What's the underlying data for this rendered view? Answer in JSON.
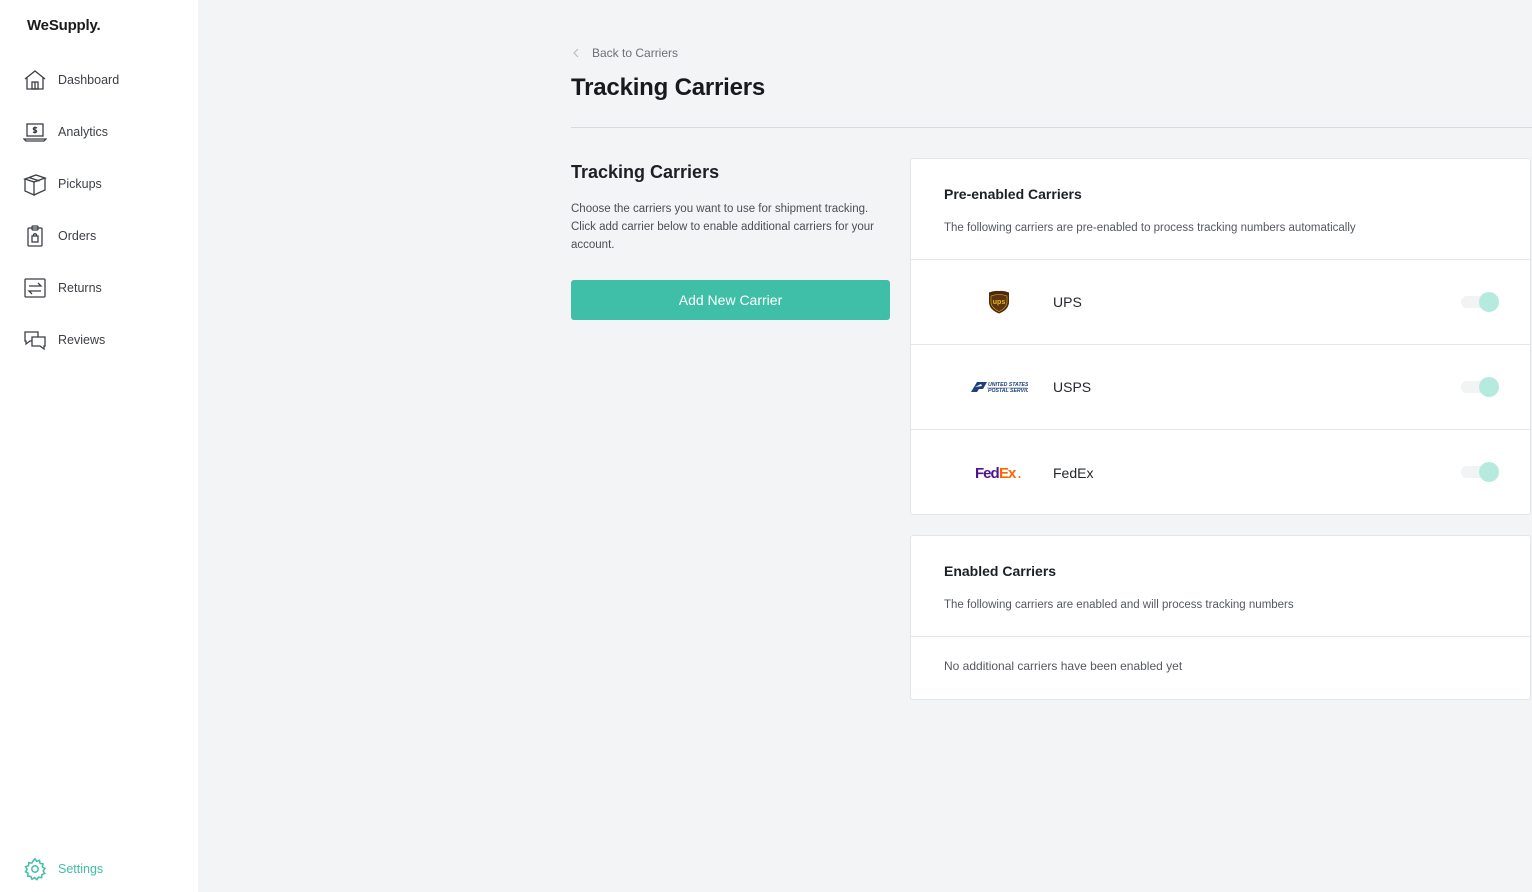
{
  "app": {
    "brand": "WeSupply."
  },
  "sidebar": {
    "items": [
      {
        "label": "Dashboard",
        "icon": "home-icon"
      },
      {
        "label": "Analytics",
        "icon": "laptop-dollar-icon"
      },
      {
        "label": "Pickups",
        "icon": "box-icon"
      },
      {
        "label": "Orders",
        "icon": "clipboard-icon"
      },
      {
        "label": "Returns",
        "icon": "returns-icon"
      },
      {
        "label": "Reviews",
        "icon": "chat-icon"
      }
    ],
    "settings": {
      "label": "Settings",
      "icon": "gear-icon"
    }
  },
  "header": {
    "back_label": "Back to Carriers",
    "title": "Tracking Carriers"
  },
  "intro": {
    "title": "Tracking Carriers",
    "description": "Choose the carriers you want to use for shipment tracking. Click add carrier below to enable additional carriers for your account.",
    "add_button": "Add New Carrier"
  },
  "pre_enabled": {
    "title": "Pre-enabled Carriers",
    "subtitle": "The following carriers are pre-enabled to process tracking numbers automatically",
    "carriers": [
      {
        "name": "UPS",
        "logo": "ups-logo",
        "enabled": true
      },
      {
        "name": "USPS",
        "logo": "usps-logo",
        "enabled": true
      },
      {
        "name": "FedEx",
        "logo": "fedex-logo",
        "enabled": true
      }
    ]
  },
  "enabled": {
    "title": "Enabled Carriers",
    "subtitle": "The following carriers are enabled and will process tracking numbers",
    "empty_text": "No additional carriers have been enabled yet"
  },
  "colors": {
    "accent": "#3fbfa8",
    "toggle_knob": "#b7eadf",
    "background": "#f3f4f6"
  }
}
